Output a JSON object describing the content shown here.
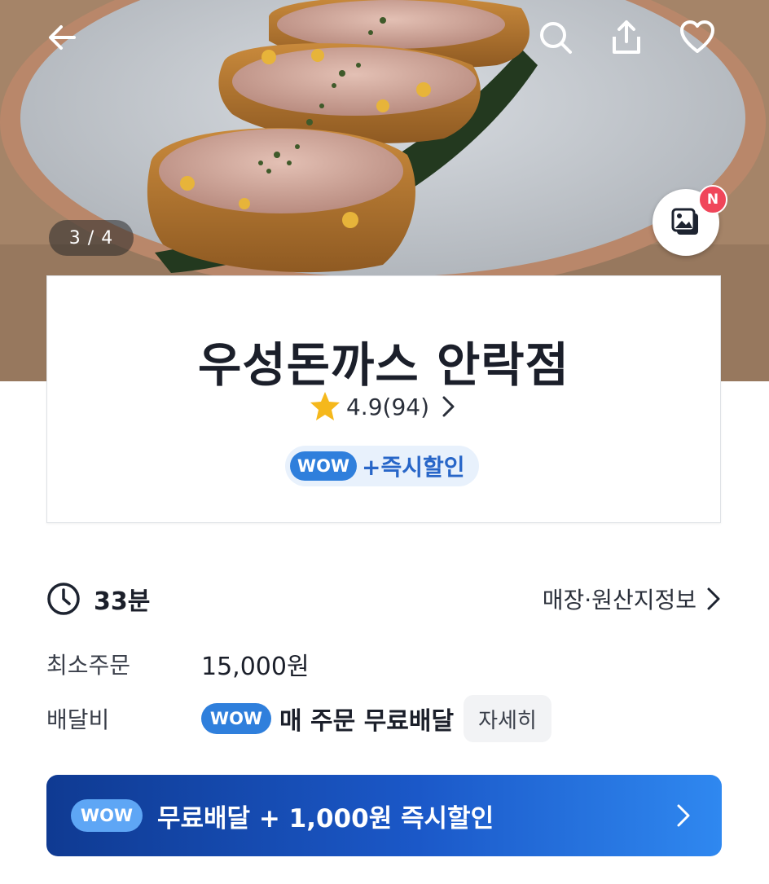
{
  "hero": {
    "page_counter": "3 / 4",
    "new_badge": "N",
    "icons": {
      "back": "back-arrow-icon",
      "search": "search-icon",
      "share": "share-icon",
      "favorite": "heart-icon",
      "gallery": "photo-gallery-icon"
    }
  },
  "store": {
    "name": "우성돈까스 안락점",
    "rating": "4.9(94)",
    "wow_label": "WOW",
    "promo": "+즉시할인"
  },
  "info": {
    "delivery_time": "33분",
    "store_info_link": "매장·원산지정보",
    "min_order_label": "최소주문",
    "min_order_value": "15,000원",
    "delivery_fee_label": "배달비",
    "wow_label": "WOW",
    "delivery_fee_value": "매 주문 무료배달",
    "detail_button": "자세히"
  },
  "banner": {
    "wow_label": "WOW",
    "text": "무료배달 + 1,000원 즉시할인"
  },
  "colors": {
    "wow_blue": "#2f7fdc",
    "promo_text": "#2866c8",
    "badge_red": "#f0465a",
    "star": "#f5b81c"
  }
}
